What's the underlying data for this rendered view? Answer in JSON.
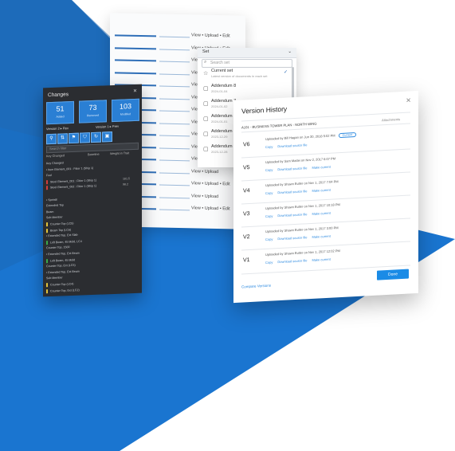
{
  "colors": {
    "brand_blue": "#1d75cc",
    "accent": "#2f8be0",
    "dark_panel": "#2b2d31",
    "stat_blue": "#2a7fd4"
  },
  "list_panel": {
    "rows": [
      {
        "label": "View • Upload • Edit"
      },
      {
        "label": "View • Upload • Edit"
      },
      {
        "label": "View • Upload"
      },
      {
        "label": "View • Upload"
      },
      {
        "label": "View • Upload"
      },
      {
        "label": "View • Upload"
      },
      {
        "label": "View • Upload"
      },
      {
        "label": "View • Upload"
      },
      {
        "label": "View • Upload"
      },
      {
        "label": "View • Upload"
      },
      {
        "label": "View • Upload"
      },
      {
        "label": "View • Upload"
      },
      {
        "label": "View • Upload • Edit"
      },
      {
        "label": "View • Upload"
      },
      {
        "label": "View • Upload • Edit"
      }
    ]
  },
  "dropdown": {
    "header": "Set",
    "chevron_icon": "chevron-down-icon",
    "search_placeholder": "Search set",
    "items": [
      {
        "icon": "star-icon",
        "title": "Current set",
        "subtitle": "Latest version of documents in each set",
        "checked": "✓"
      },
      {
        "icon": "doc-icon",
        "title": "Addendum 8",
        "subtitle": "2024-01-04",
        "checked": ""
      },
      {
        "icon": "doc-icon",
        "title": "Addendum 7",
        "subtitle": "2024-01-02",
        "checked": ""
      },
      {
        "icon": "doc-icon",
        "title": "Addendum",
        "subtitle": "2024-01-01",
        "checked": ""
      },
      {
        "icon": "doc-icon",
        "title": "Addendum",
        "subtitle": "2023-12-29",
        "checked": ""
      },
      {
        "icon": "doc-icon",
        "title": "Addendum",
        "subtitle": "2023-12-28",
        "checked": ""
      }
    ]
  },
  "dark_panel": {
    "title": "Changes",
    "close_glyph": "✕",
    "stats": [
      {
        "value": "51",
        "label": "Added"
      },
      {
        "value": "73",
        "label": "Removed"
      },
      {
        "value": "103",
        "label": "Modified"
      }
    ],
    "tabs": [
      "Version 2 ▸ Rev",
      "Version 1 ▸ Prev"
    ],
    "filter_placeholder": "Search filter",
    "columns": [
      "Key Changed",
      "Baseline",
      "Weight in Trait"
    ],
    "tree": [
      {
        "text": "Key Changed",
        "value": "",
        "swatch": ""
      },
      {
        "text": "• Item Element_001 : Fitter 1 (Ship 1)",
        "value": "",
        "swatch": ""
      },
      {
        "text": "  Fuel",
        "value": "",
        "swatch": ""
      },
      {
        "text": "    Steel Element_001 : Fitter 1 (Ship 1)",
        "value": "101.5",
        "swatch": "#d23b3b"
      },
      {
        "text": "    Steel Element_002 : Fitter 1 (Ship 1)",
        "value": "98.2",
        "swatch": "#d23b3b"
      },
      {
        "text": "",
        "value": "",
        "swatch": ""
      },
      {
        "text": "• Sprint8",
        "value": "",
        "swatch": ""
      },
      {
        "text": "  Extended Top",
        "value": "",
        "swatch": ""
      },
      {
        "text": "    Beam",
        "value": "",
        "swatch": ""
      },
      {
        "text": "      Sub Member",
        "value": "",
        "swatch": ""
      },
      {
        "text": "      Counter Top (LC5)",
        "value": "",
        "swatch": "#e0c23a"
      },
      {
        "text": "      Beam Top (LC6)",
        "value": "",
        "swatch": "#e0c23a"
      },
      {
        "text": "• Extended Top, Ext Slab",
        "value": "",
        "swatch": ""
      },
      {
        "text": "  Left Beam, 45 Mold, LC4",
        "value": "",
        "swatch": "#3aa84a"
      },
      {
        "text": "  Counter Top, 1500",
        "value": "",
        "swatch": ""
      },
      {
        "text": "• Extended Top, Ext Beam",
        "value": "",
        "swatch": ""
      },
      {
        "text": "  Left Beam, 45 Mold",
        "value": "",
        "swatch": "#3aa84a"
      },
      {
        "text": "  Counter Top, Ext (LC5)",
        "value": "",
        "swatch": ""
      },
      {
        "text": "• Extended Top, Ext Beam",
        "value": "",
        "swatch": ""
      },
      {
        "text": "  Sub Member",
        "value": "",
        "swatch": ""
      },
      {
        "text": "  Counter Top (LC4)",
        "value": "",
        "swatch": "#e0c23a"
      },
      {
        "text": "  Counter Top, Ext (LC2)",
        "value": "",
        "swatch": "#e0c23a"
      }
    ]
  },
  "version_history": {
    "title": "Version History",
    "close_glyph": "✕",
    "file_name": "A101 - BUSINESS TOWER PLAN - NORTH WING",
    "attachments": "Attachments",
    "versions": [
      {
        "id": "V6",
        "uploader": "Uploaded by Bill Hagan on Jun 30, 2018 5:02 PM",
        "current": "Current",
        "links": [
          "Copy",
          "Download source file"
        ]
      },
      {
        "id": "V5",
        "uploader": "Uploaded by Sam Mattei on Nov 2, 2017 6:07 PM",
        "current": "",
        "links": [
          "Copy",
          "Download source file",
          "Make current"
        ]
      },
      {
        "id": "V4",
        "uploader": "Uploaded by Shawn Butler on Nov 1, 2017 7:04 PM",
        "current": "",
        "links": [
          "Copy",
          "Download source file",
          "Make current"
        ]
      },
      {
        "id": "V3",
        "uploader": "Uploaded by Shawn Butler on Nov 1, 2017 10:18 PM",
        "current": "",
        "links": [
          "Copy",
          "Download source file",
          "Make current"
        ]
      },
      {
        "id": "V2",
        "uploader": "Uploaded by Shawn Butler on Nov 1, 2017 3:00 PM",
        "current": "",
        "links": [
          "Copy",
          "Download source file",
          "Make current"
        ]
      },
      {
        "id": "V1",
        "uploader": "Uploaded by Shawn Butler on Nov 1, 2017 12:02 PM",
        "current": "",
        "links": [
          "Copy",
          "Download source file",
          "Make current"
        ]
      }
    ],
    "compare_link": "Compare Versions",
    "done_button": "Done"
  }
}
